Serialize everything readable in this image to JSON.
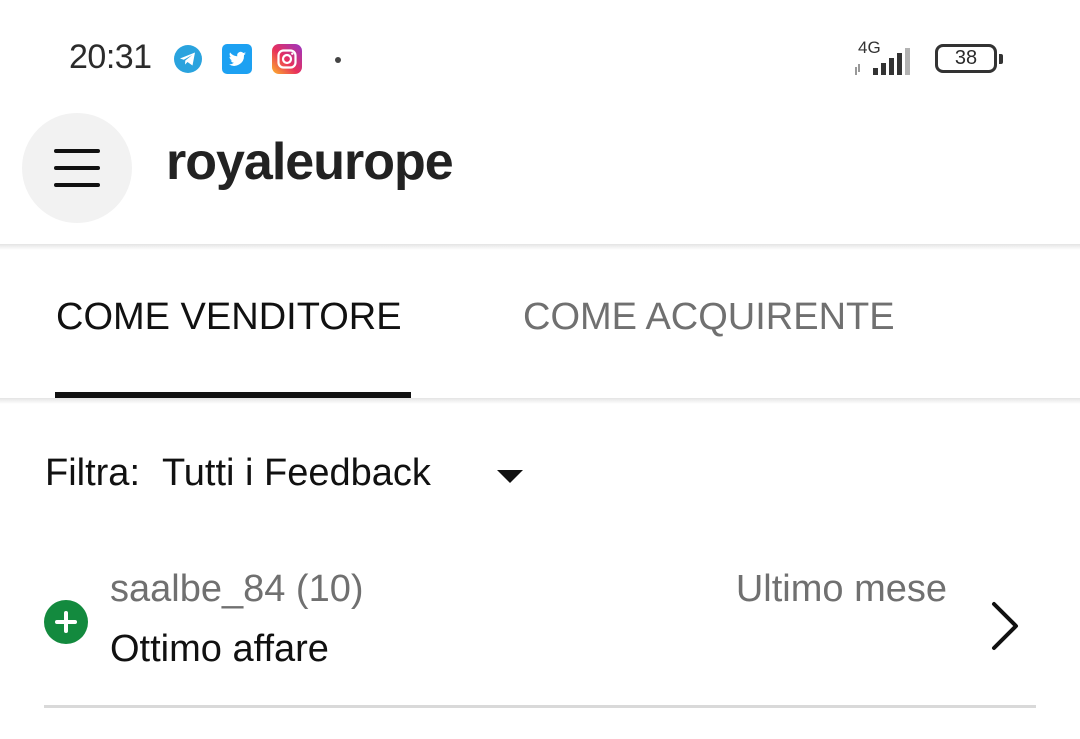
{
  "status_bar": {
    "time": "20:31",
    "network_type": "4G",
    "battery": "38",
    "icons": [
      "telegram-icon",
      "twitter-icon",
      "instagram-icon"
    ]
  },
  "header": {
    "title": "royaleurope",
    "menu_icon": "hamburger-menu-icon"
  },
  "tabs": [
    {
      "label": "COME VENDITORE",
      "active": true
    },
    {
      "label": "COME ACQUIRENTE",
      "active": false
    }
  ],
  "filter": {
    "label": "Filtra:",
    "value": "Tutti i Feedback"
  },
  "feedback": [
    {
      "user": "saalbe_84 (10)",
      "comment": "Ottimo affare",
      "date": "Ultimo mese",
      "type": "positive"
    }
  ],
  "colors": {
    "positive": "#138a3e",
    "text_primary": "#111111",
    "text_secondary": "#707070",
    "telegram": "#2aa3de",
    "twitter": "#1da1f2"
  }
}
